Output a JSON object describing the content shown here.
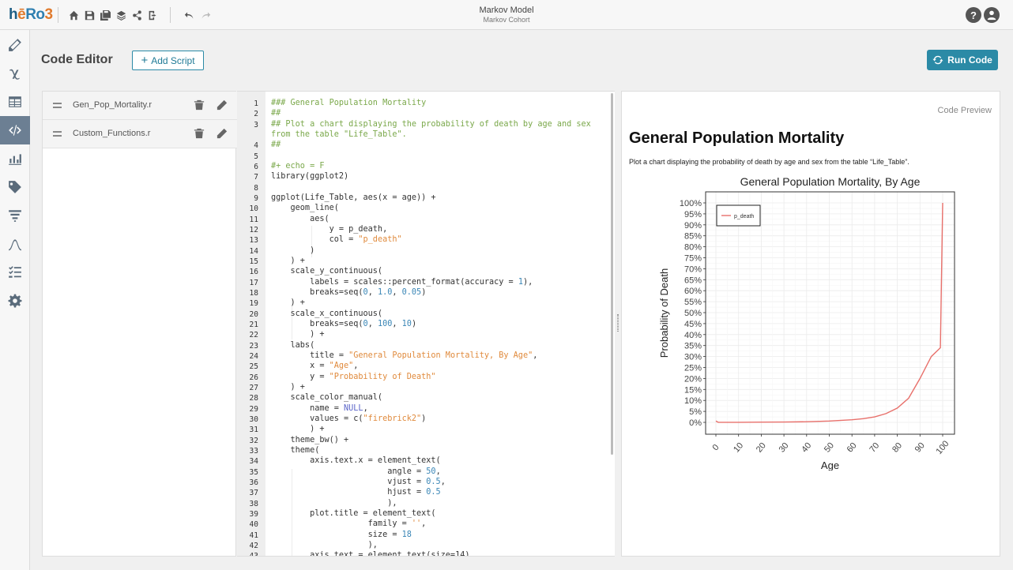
{
  "app": {
    "logo_parts": [
      "h",
      "ē",
      "Ro",
      "3"
    ],
    "title": "Markov Model",
    "subtitle": "Markov Cohort",
    "help_label": "?"
  },
  "toolbar_icons": [
    "home-icon",
    "save-icon",
    "save-all-icon",
    "layers-icon",
    "share-icon",
    "export-icon",
    "undo-icon",
    "redo-icon"
  ],
  "rail_icons": [
    "pencil-icon",
    "variable-icon",
    "table-icon",
    "code-icon",
    "bar-chart-icon",
    "tag-icon",
    "filter-icon",
    "curve-icon",
    "checklist-icon",
    "settings-icon"
  ],
  "page": {
    "title": "Code Editor",
    "add_script_label": "Add Script",
    "run_code_label": "Run Code"
  },
  "scripts": [
    {
      "name": "Gen_Pop_Mortality.r"
    },
    {
      "name": "Custom_Functions.r"
    }
  ],
  "editor": {
    "line_numbers": [
      "1",
      "2",
      "3",
      "",
      "4",
      "5",
      "6",
      "7",
      "8",
      "9",
      "10",
      "11",
      "12",
      "13",
      "14",
      "15",
      "16",
      "17",
      "18",
      "19",
      "20",
      "21",
      "22",
      "23",
      "24",
      "25",
      "26",
      "27",
      "28",
      "29",
      "30",
      "31",
      "32",
      "33",
      "34",
      "35",
      "36",
      "37",
      "38",
      "39",
      "40",
      "41",
      "42",
      "43"
    ]
  },
  "preview": {
    "label": "Code Preview",
    "heading": "General Population Mortality",
    "description": "Plot a chart displaying the probability of death by age and sex from the table “Life_Table”."
  },
  "chart_data": {
    "type": "line",
    "title": "General Population Mortality, By Age",
    "xlabel": "Age",
    "ylabel": "Probability of Death",
    "xlim": [
      0,
      100
    ],
    "ylim": [
      0,
      1
    ],
    "x_ticks": [
      "0",
      "10",
      "20",
      "30",
      "40",
      "50",
      "60",
      "70",
      "80",
      "90",
      "100"
    ],
    "y_ticks": [
      "0%",
      "5%",
      "10%",
      "15%",
      "20%",
      "25%",
      "30%",
      "35%",
      "40%",
      "45%",
      "50%",
      "55%",
      "60%",
      "65%",
      "70%",
      "75%",
      "80%",
      "85%",
      "90%",
      "95%",
      "100%"
    ],
    "grid": true,
    "legend_position": "top-left",
    "color": "#e8706b",
    "series": [
      {
        "name": "p_death",
        "x": [
          0,
          1,
          5,
          10,
          20,
          30,
          40,
          50,
          60,
          65,
          70,
          75,
          80,
          85,
          90,
          95,
          99,
          100
        ],
        "y": [
          0.006,
          0.0005,
          0.0003,
          0.0004,
          0.001,
          0.0015,
          0.003,
          0.006,
          0.012,
          0.017,
          0.025,
          0.04,
          0.065,
          0.11,
          0.2,
          0.3,
          0.34,
          1.0
        ]
      }
    ]
  }
}
